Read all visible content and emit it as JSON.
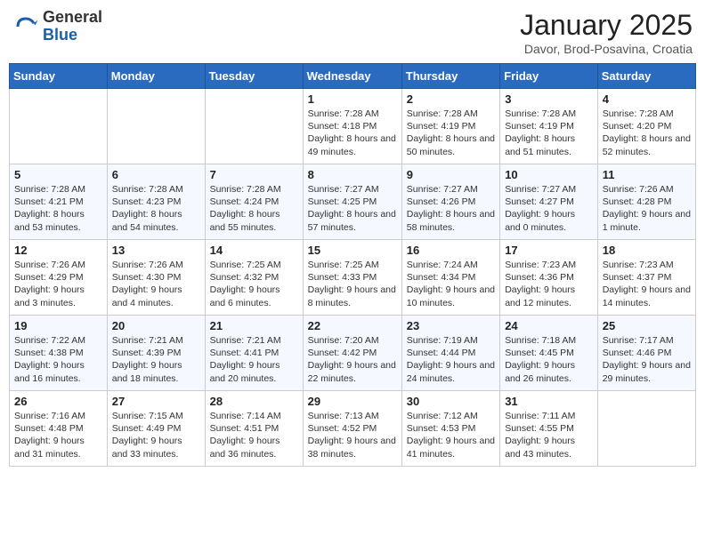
{
  "header": {
    "logo_general": "General",
    "logo_blue": "Blue",
    "title": "January 2025",
    "location": "Davor, Brod-Posavina, Croatia"
  },
  "weekdays": [
    "Sunday",
    "Monday",
    "Tuesday",
    "Wednesday",
    "Thursday",
    "Friday",
    "Saturday"
  ],
  "weeks": [
    [
      {
        "day": "",
        "info": ""
      },
      {
        "day": "",
        "info": ""
      },
      {
        "day": "",
        "info": ""
      },
      {
        "day": "1",
        "info": "Sunrise: 7:28 AM\nSunset: 4:18 PM\nDaylight: 8 hours and 49 minutes."
      },
      {
        "day": "2",
        "info": "Sunrise: 7:28 AM\nSunset: 4:19 PM\nDaylight: 8 hours and 50 minutes."
      },
      {
        "day": "3",
        "info": "Sunrise: 7:28 AM\nSunset: 4:19 PM\nDaylight: 8 hours and 51 minutes."
      },
      {
        "day": "4",
        "info": "Sunrise: 7:28 AM\nSunset: 4:20 PM\nDaylight: 8 hours and 52 minutes."
      }
    ],
    [
      {
        "day": "5",
        "info": "Sunrise: 7:28 AM\nSunset: 4:21 PM\nDaylight: 8 hours and 53 minutes."
      },
      {
        "day": "6",
        "info": "Sunrise: 7:28 AM\nSunset: 4:23 PM\nDaylight: 8 hours and 54 minutes."
      },
      {
        "day": "7",
        "info": "Sunrise: 7:28 AM\nSunset: 4:24 PM\nDaylight: 8 hours and 55 minutes."
      },
      {
        "day": "8",
        "info": "Sunrise: 7:27 AM\nSunset: 4:25 PM\nDaylight: 8 hours and 57 minutes."
      },
      {
        "day": "9",
        "info": "Sunrise: 7:27 AM\nSunset: 4:26 PM\nDaylight: 8 hours and 58 minutes."
      },
      {
        "day": "10",
        "info": "Sunrise: 7:27 AM\nSunset: 4:27 PM\nDaylight: 9 hours and 0 minutes."
      },
      {
        "day": "11",
        "info": "Sunrise: 7:26 AM\nSunset: 4:28 PM\nDaylight: 9 hours and 1 minute."
      }
    ],
    [
      {
        "day": "12",
        "info": "Sunrise: 7:26 AM\nSunset: 4:29 PM\nDaylight: 9 hours and 3 minutes."
      },
      {
        "day": "13",
        "info": "Sunrise: 7:26 AM\nSunset: 4:30 PM\nDaylight: 9 hours and 4 minutes."
      },
      {
        "day": "14",
        "info": "Sunrise: 7:25 AM\nSunset: 4:32 PM\nDaylight: 9 hours and 6 minutes."
      },
      {
        "day": "15",
        "info": "Sunrise: 7:25 AM\nSunset: 4:33 PM\nDaylight: 9 hours and 8 minutes."
      },
      {
        "day": "16",
        "info": "Sunrise: 7:24 AM\nSunset: 4:34 PM\nDaylight: 9 hours and 10 minutes."
      },
      {
        "day": "17",
        "info": "Sunrise: 7:23 AM\nSunset: 4:36 PM\nDaylight: 9 hours and 12 minutes."
      },
      {
        "day": "18",
        "info": "Sunrise: 7:23 AM\nSunset: 4:37 PM\nDaylight: 9 hours and 14 minutes."
      }
    ],
    [
      {
        "day": "19",
        "info": "Sunrise: 7:22 AM\nSunset: 4:38 PM\nDaylight: 9 hours and 16 minutes."
      },
      {
        "day": "20",
        "info": "Sunrise: 7:21 AM\nSunset: 4:39 PM\nDaylight: 9 hours and 18 minutes."
      },
      {
        "day": "21",
        "info": "Sunrise: 7:21 AM\nSunset: 4:41 PM\nDaylight: 9 hours and 20 minutes."
      },
      {
        "day": "22",
        "info": "Sunrise: 7:20 AM\nSunset: 4:42 PM\nDaylight: 9 hours and 22 minutes."
      },
      {
        "day": "23",
        "info": "Sunrise: 7:19 AM\nSunset: 4:44 PM\nDaylight: 9 hours and 24 minutes."
      },
      {
        "day": "24",
        "info": "Sunrise: 7:18 AM\nSunset: 4:45 PM\nDaylight: 9 hours and 26 minutes."
      },
      {
        "day": "25",
        "info": "Sunrise: 7:17 AM\nSunset: 4:46 PM\nDaylight: 9 hours and 29 minutes."
      }
    ],
    [
      {
        "day": "26",
        "info": "Sunrise: 7:16 AM\nSunset: 4:48 PM\nDaylight: 9 hours and 31 minutes."
      },
      {
        "day": "27",
        "info": "Sunrise: 7:15 AM\nSunset: 4:49 PM\nDaylight: 9 hours and 33 minutes."
      },
      {
        "day": "28",
        "info": "Sunrise: 7:14 AM\nSunset: 4:51 PM\nDaylight: 9 hours and 36 minutes."
      },
      {
        "day": "29",
        "info": "Sunrise: 7:13 AM\nSunset: 4:52 PM\nDaylight: 9 hours and 38 minutes."
      },
      {
        "day": "30",
        "info": "Sunrise: 7:12 AM\nSunset: 4:53 PM\nDaylight: 9 hours and 41 minutes."
      },
      {
        "day": "31",
        "info": "Sunrise: 7:11 AM\nSunset: 4:55 PM\nDaylight: 9 hours and 43 minutes."
      },
      {
        "day": "",
        "info": ""
      }
    ]
  ]
}
